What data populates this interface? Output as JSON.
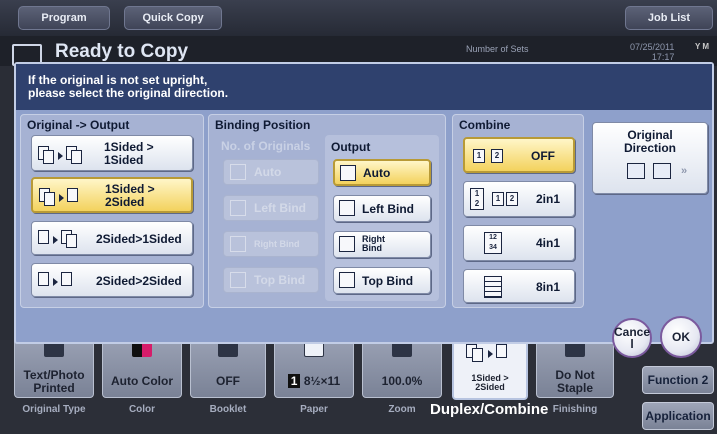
{
  "topbar": {
    "program_label": "Program",
    "quickcopy_label": "Quick Copy",
    "joblist_label": "Job List"
  },
  "status": {
    "ready_text": "Ready to Copy",
    "sets_label": "Number of Sets",
    "date": "07/25/2011",
    "time": "17:17",
    "toner": "Y M"
  },
  "dialog": {
    "message_line1": "If the original is not set upright,",
    "message_line2": "please select the original direction.",
    "orig_output": {
      "title": "Original -> Output",
      "options": [
        {
          "label": "1Sided > 1Sided",
          "line1": "1Sided >",
          "line2": "1Sided",
          "selected": false
        },
        {
          "label": "1Sided > 2Sided",
          "line1": "1Sided >",
          "line2": "2Sided",
          "selected": true
        },
        {
          "label": "2Sided>1Sided",
          "selected": false
        },
        {
          "label": "2Sided>2Sided",
          "selected": false
        }
      ]
    },
    "binding": {
      "title": "Binding Position",
      "originals_title": "No. of Originals",
      "originals": [
        "Auto",
        "Left Bind",
        "Right Bind",
        "Top Bind"
      ],
      "output_title": "Output",
      "output": [
        {
          "label": "Auto",
          "selected": true
        },
        {
          "label": "Left Bind",
          "selected": false
        },
        {
          "label": "Right Bind",
          "line1": "Right",
          "line2": "Bind",
          "selected": false
        },
        {
          "label": "Top Bind",
          "selected": false
        }
      ]
    },
    "combine": {
      "title": "Combine",
      "options": [
        {
          "label": "OFF",
          "selected": true
        },
        {
          "label": "2in1",
          "selected": false
        },
        {
          "label": "4in1",
          "selected": false
        },
        {
          "label": "8in1",
          "selected": false
        }
      ]
    },
    "original_direction": {
      "line1": "Original",
      "line2": "Direction"
    },
    "cancel_line1": "Cance",
    "cancel_line2": "l",
    "ok_label": "OK"
  },
  "bottom": {
    "buttons": [
      {
        "value": "Text/Photo Printed",
        "value1": "Text/Photo",
        "value2": "Printed",
        "label": "Original Type"
      },
      {
        "value": "Auto Color",
        "label": "Color"
      },
      {
        "value": "OFF",
        "label": "Booklet"
      },
      {
        "value": "8½×11",
        "label": "Paper",
        "tray": "1"
      },
      {
        "value": "100.0%",
        "label": "Zoom"
      },
      {
        "value": "Do Not Staple",
        "value1": "Do Not",
        "value2": "Staple",
        "label": "Finishing"
      }
    ],
    "duplex": {
      "value1": "1Sided >",
      "value2": "2Sided",
      "label": "Duplex/Combine"
    },
    "function2_label": "Function 2",
    "application_label": "Application"
  },
  "colors": {
    "dialog_bg": "#8ea0cb",
    "message_bg": "#2f416e",
    "selected_fill": "#f3d25d",
    "cancel_border": "#7b5a9e"
  }
}
